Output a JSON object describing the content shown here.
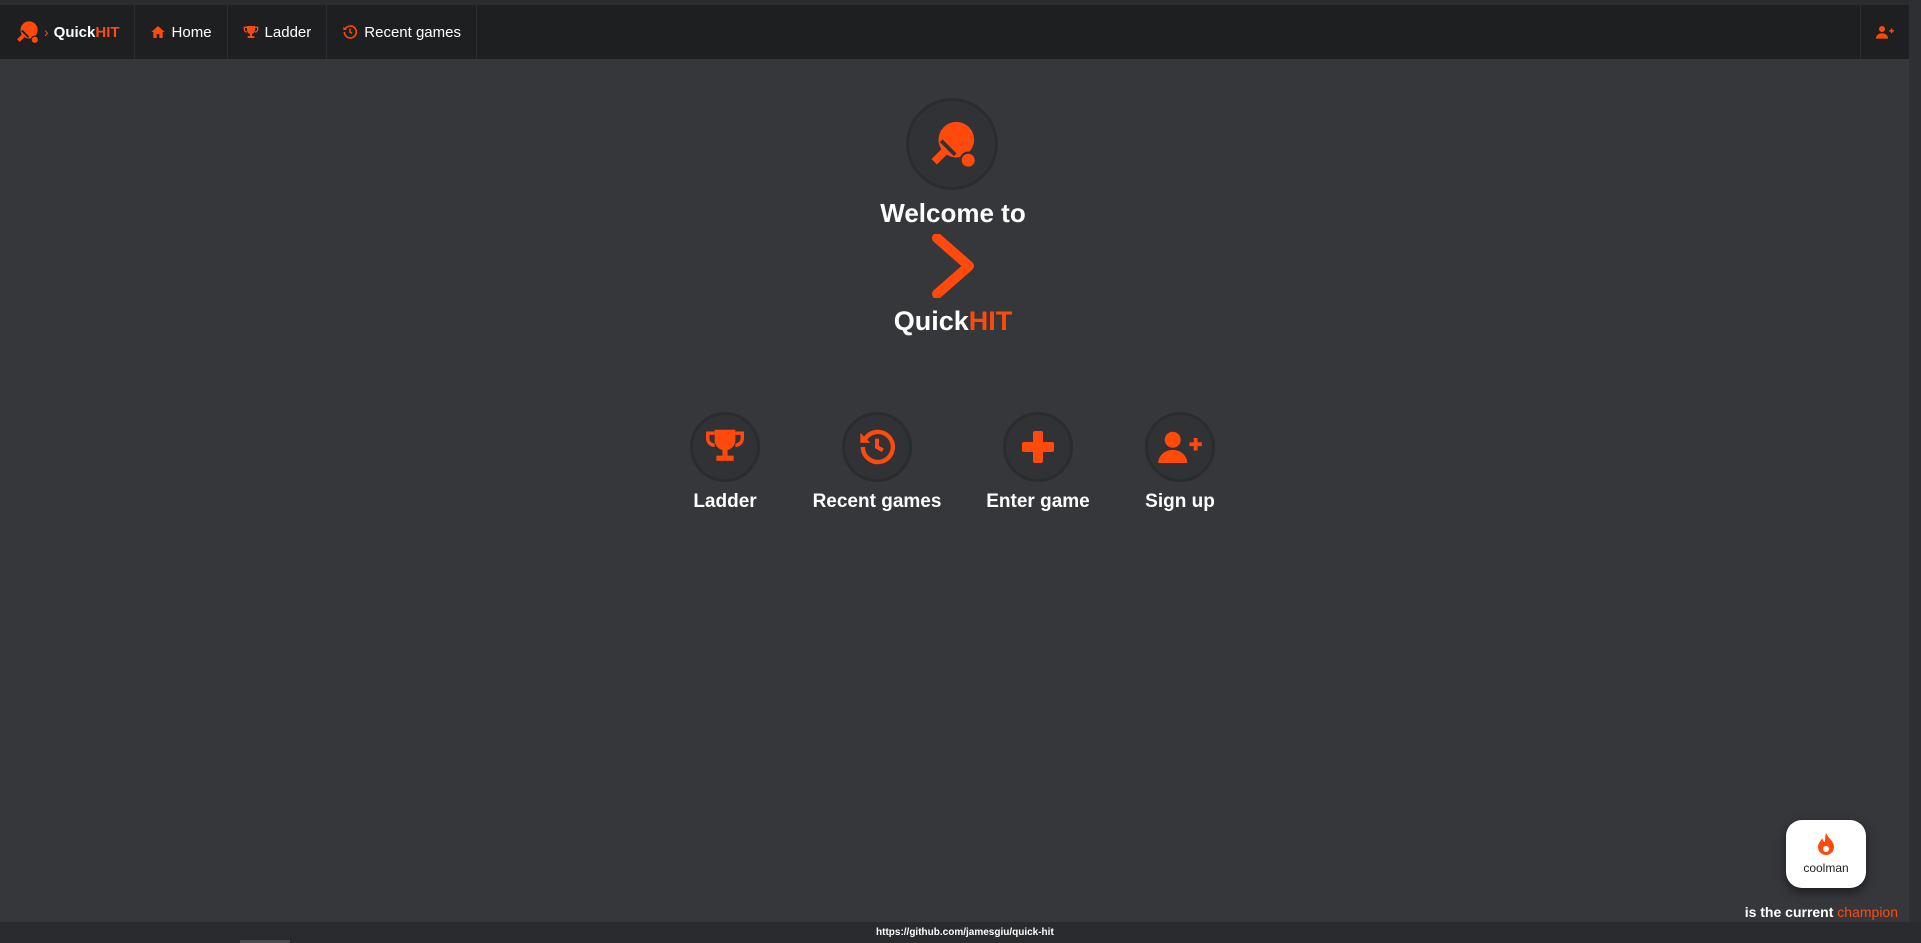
{
  "colors": {
    "accent": "#ff4a0c",
    "background": "#36373b",
    "navbar": "#1e1f21",
    "text": "#ffffff"
  },
  "navbar": {
    "brand": {
      "prefix": "Quick",
      "accent": "HIT",
      "icon": "ping-pong-icon"
    },
    "items": [
      {
        "label": "Home",
        "icon": "home-icon"
      },
      {
        "label": "Ladder",
        "icon": "trophy-icon"
      },
      {
        "label": "Recent games",
        "icon": "history-icon"
      }
    ],
    "right_icon": "user-plus-icon"
  },
  "hero": {
    "welcome": "Welcome to",
    "brand_prefix": "Quick",
    "brand_accent": "HIT",
    "logo_icon": "ping-pong-icon",
    "chevron_icon": "chevron-right-icon"
  },
  "actions": [
    {
      "label": "Ladder",
      "icon": "trophy-icon"
    },
    {
      "label": "Recent games",
      "icon": "history-icon"
    },
    {
      "label": "Enter game",
      "icon": "plus-icon"
    },
    {
      "label": "Sign up",
      "icon": "user-plus-icon"
    }
  ],
  "champion": {
    "name": "coolman",
    "icon": "flame-icon",
    "text_prefix": "is the current",
    "text_accent": "champion"
  },
  "status": {
    "url": "https://github.com/jamesgiu/quick-hit"
  }
}
